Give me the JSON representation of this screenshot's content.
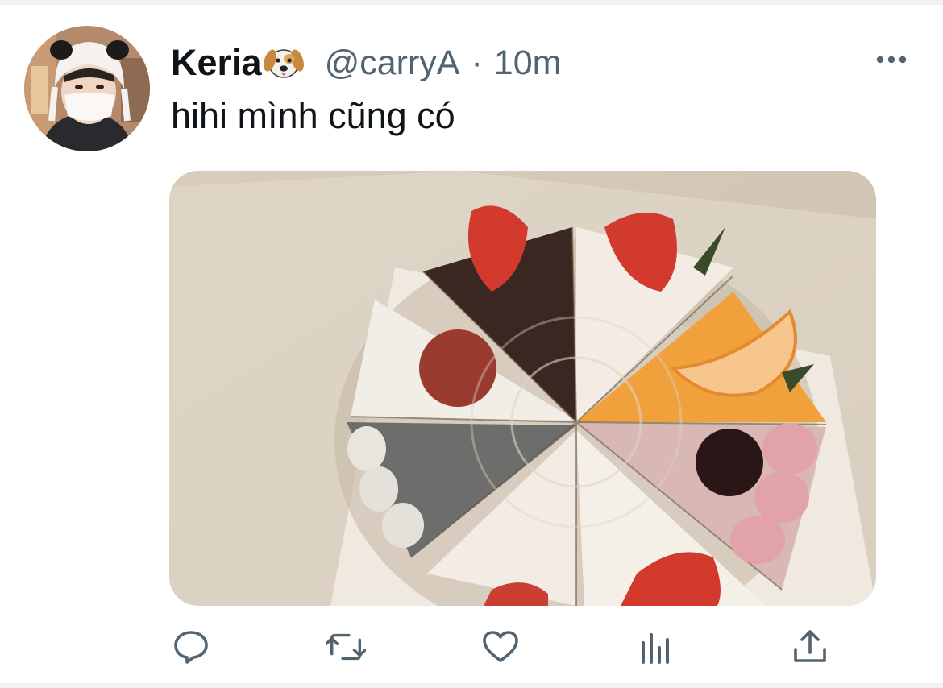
{
  "tweet": {
    "display_name": "Keria",
    "name_emoji_icon": "dog-face-icon",
    "handle": "@carryA",
    "separator": "·",
    "time": "10m",
    "text": "hihi mình cũng có",
    "more_icon": "more-horizontal-icon",
    "media_description_icon": "photo"
  },
  "actions": [
    {
      "name": "reply",
      "icon": "reply-icon"
    },
    {
      "name": "retweet",
      "icon": "retweet-icon"
    },
    {
      "name": "like",
      "icon": "heart-icon"
    },
    {
      "name": "views",
      "icon": "views-icon"
    },
    {
      "name": "share",
      "icon": "share-icon"
    }
  ],
  "colors": {
    "primary_text": "#0f1419",
    "secondary_text": "#536471",
    "divider": "#eff1f3"
  }
}
